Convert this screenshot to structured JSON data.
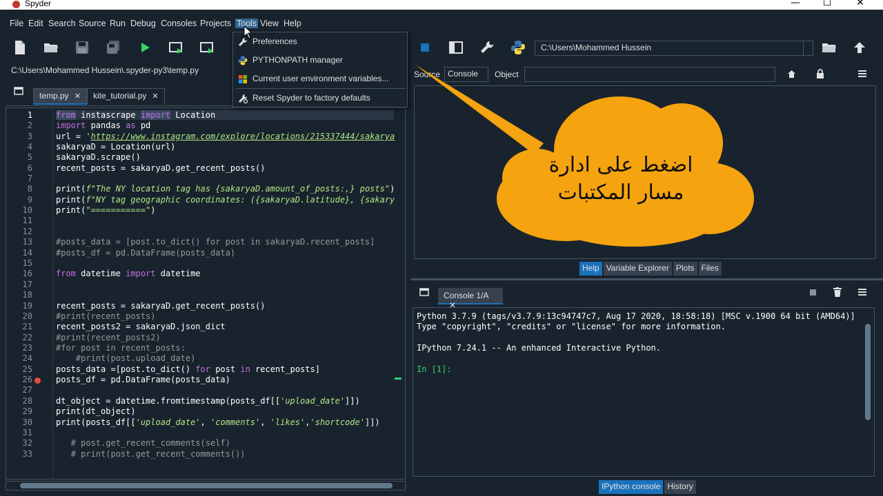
{
  "window": {
    "title": "Spyder",
    "minimize": "—",
    "maximize": "☐",
    "close": "✕"
  },
  "menubar": [
    "File",
    "Edit",
    "Search",
    "Source",
    "Run",
    "Debug",
    "Consoles",
    "Projects",
    "Tools",
    "View",
    "Help"
  ],
  "active_menu": "Tools",
  "tools_menu": {
    "items": [
      {
        "label": "Preferences",
        "icon": "wrench-icon"
      },
      {
        "label": "PYTHONPATH manager",
        "icon": "python-icon"
      },
      {
        "label": "Current user environment variables...",
        "icon": "windows-flag-icon"
      },
      {
        "label": "Reset Spyder to factory defaults",
        "icon": "reset-wrench-icon"
      }
    ]
  },
  "working_dir": "C:\\Users\\Mohammed Hussein",
  "editor": {
    "file_path": "C:\\Users\\Mohammed Hussein\\.spyder-py3\\temp.py",
    "tabs": [
      {
        "label": "temp.py",
        "close": "✕",
        "active": true
      },
      {
        "label": "kite_tutorial.py",
        "close": "✕",
        "active": false
      }
    ],
    "line_numbers": [
      "1",
      "2",
      "3",
      "4",
      "5",
      "6",
      "7",
      "8",
      "9",
      "10",
      "11",
      "12",
      "13",
      "14",
      "15",
      "16",
      "17",
      "18",
      "19",
      "20",
      "21",
      "22",
      "23",
      "24",
      "25",
      "26",
      "27",
      "28",
      "29",
      "30",
      "31",
      "32",
      "33"
    ],
    "breakpoint_line": "26",
    "code": {
      "l1_kw1": "from",
      "l1_mod": " instascrape ",
      "l1_kw2": "import",
      "l1_cls": " Location",
      "l2_kw": "import",
      "l2_rest": " pandas ",
      "l2_kw2": "as",
      "l2_rest2": " pd",
      "l3_pre": "url = ",
      "l3_q": "'",
      "l3_url": "https://www.instagram.com/explore/locations/215337444/sakarya",
      "l4": "sakaryaD = Location(url)",
      "l5": "sakaryaD.scrape()",
      "l6": "recent_posts = sakaryaD.get_recent_posts()",
      "l8_fn": "print(",
      "l8_str": "f\"The NY location tag has {sakaryaD.amount_of_posts:,} posts\"",
      "l8_end": ")",
      "l9_fn": "print(",
      "l9_str": "f\"NY tag geographic coordinates: ({sakaryaD.latitude}, {sakary",
      "l10_fn": "print(",
      "l10_str": "\"===========\"",
      "l10_end": ")",
      "l13": "#posts_data = [post.to_dict() for post in sakaryaD.recent_posts]",
      "l14": "#posts_df = pd.DataFrame(posts_data)",
      "l16_kw1": "from",
      "l16_mod": " datetime ",
      "l16_kw2": "import",
      "l16_cls": " datetime",
      "l19": "recent_posts = sakaryaD.get_recent_posts()",
      "l20": "#print(recent_posts)",
      "l21": "recent_posts2 = sakaryaD.json_dict",
      "l22": "#print(recent_posts2)",
      "l23": "#for post in recent_posts:",
      "l24": "    #print(post.upload_date)",
      "l25_a": "posts_data =[post.to_dict() ",
      "l25_kw": "for",
      "l25_b": " post ",
      "l25_kw2": "in",
      "l25_c": " recent_posts]",
      "l26": "posts_df = pd.DataFrame(posts_data)",
      "l28_a": "dt_object = datetime.fromtimestamp(posts_df[[",
      "l28_str": "'upload_date'",
      "l28_b": "]])",
      "l29": "print(dt_object)",
      "l30_a": "print(posts_df[[",
      "l30_s1": "'upload_date'",
      "l30_c1": ", ",
      "l30_s2": "'comments'",
      "l30_c2": ", ",
      "l30_s3": "'likes'",
      "l30_c3": ",",
      "l30_s4": "'shortcode'",
      "l30_b": "]])",
      "l32": "   # post.get_recent_comments(self)",
      "l33": "   # print(post.get_recent_comments())"
    }
  },
  "help_pane": {
    "source_label": "Source",
    "source_value": "Console",
    "object_label": "Object",
    "object_value": "",
    "tabs": [
      {
        "label": "Help",
        "active": true
      },
      {
        "label": "Variable Explorer",
        "active": false
      },
      {
        "label": "Plots",
        "active": false
      },
      {
        "label": "Files",
        "active": false
      }
    ]
  },
  "console": {
    "tab_label": "Console 1/A",
    "tab_close": "✕",
    "lines": [
      "Python 3.7.9 (tags/v3.7.9:13c94747c7, Aug 17 2020, 18:58:18) [MSC v.1900 64 bit (AMD64)]",
      "Type \"copyright\", \"credits\" or \"license\" for more information.",
      "",
      "IPython 7.24.1 -- An enhanced Interactive Python.",
      "",
      "In [1]:"
    ],
    "bottom_tabs": [
      {
        "label": "IPython console",
        "active": true
      },
      {
        "label": "History",
        "active": false
      }
    ]
  },
  "annotation": {
    "line1": "اضغط على ادارة",
    "line2": "مسار المكتبات",
    "color": "#f5a30f"
  },
  "colors": {
    "background": "#19232d",
    "accent": "#1a72bb",
    "border": "#455364",
    "keyword": "#c670e0",
    "string": "#b0e686",
    "comment": "#999999",
    "run_green": "#3ad36a"
  }
}
